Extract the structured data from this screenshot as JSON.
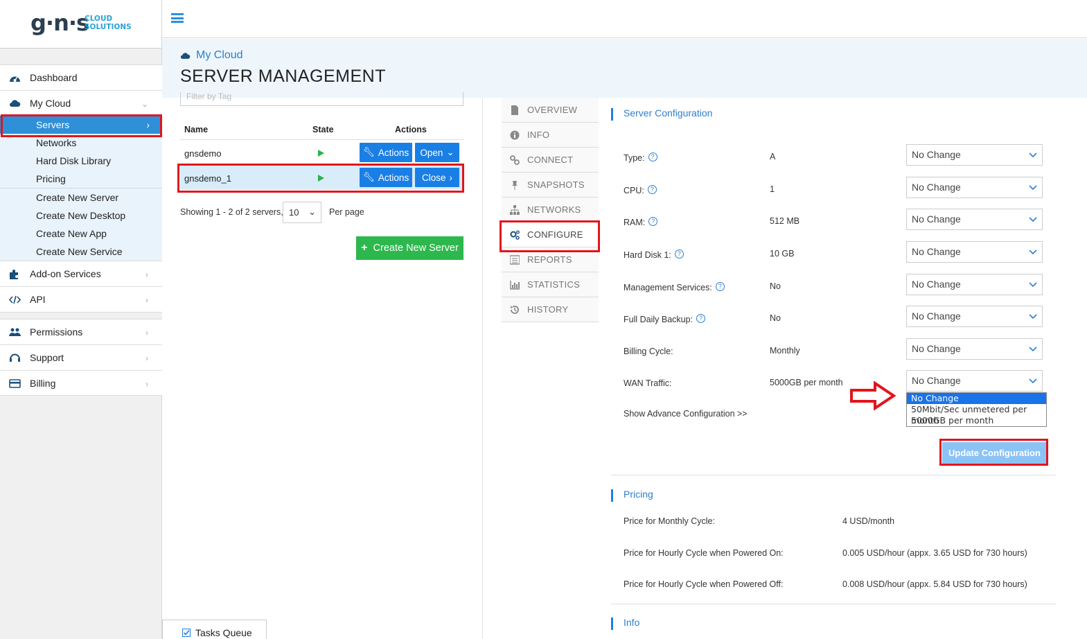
{
  "logo": {
    "brand": "g·n·s",
    "tagline_line1": "CLOUD",
    "tagline_line2": "SOLUTIONS"
  },
  "sidebar": {
    "dashboard": "Dashboard",
    "my_cloud": "My Cloud",
    "servers": "Servers",
    "networks": "Networks",
    "hard_disk_library": "Hard Disk Library",
    "pricing": "Pricing",
    "create_new_server": "Create New Server",
    "create_new_desktop": "Create New Desktop",
    "create_new_app": "Create New App",
    "create_new_service": "Create New Service",
    "addon_services": "Add-on Services",
    "api": "API",
    "permissions": "Permissions",
    "support": "Support",
    "billing": "Billing"
  },
  "header": {
    "breadcrumb": "My Cloud",
    "title": "SERVER MANAGEMENT"
  },
  "server_list": {
    "filter_placeholder": "Filter by Tag",
    "columns": {
      "name": "Name",
      "state": "State",
      "actions": "Actions"
    },
    "rows": [
      {
        "name": "gnsdemo",
        "actions_label": "Actions",
        "toggle_label": "Open"
      },
      {
        "name": "gnsdemo_1",
        "actions_label": "Actions",
        "toggle_label": "Close"
      }
    ],
    "showing": "Showing 1 - 2 of 2 servers,",
    "per_page_value": "10",
    "per_page_label": "Per page",
    "create_button": "Create New Server",
    "tasks_queue": "Tasks Queue"
  },
  "tabs": [
    "OVERVIEW",
    "INFO",
    "CONNECT",
    "SNAPSHOTS",
    "NETWORKS",
    "CONFIGURE",
    "REPORTS",
    "STATISTICS",
    "HISTORY"
  ],
  "active_tab": "CONFIGURE",
  "server_config": {
    "heading": "Server Configuration",
    "rows": [
      {
        "label": "Type:",
        "value": "A",
        "select": "No Change",
        "help": true
      },
      {
        "label": "CPU:",
        "value": "1",
        "select": "No Change",
        "help": true
      },
      {
        "label": "RAM:",
        "value": "512 MB",
        "select": "No Change",
        "help": true
      },
      {
        "label": "Hard Disk 1:",
        "value": "10 GB",
        "select": "No Change",
        "help": true
      },
      {
        "label": "Management Services:",
        "value": "No",
        "select": "No Change",
        "help": true
      },
      {
        "label": "Full Daily Backup:",
        "value": "No",
        "select": "No Change",
        "help": true
      },
      {
        "label": "Billing Cycle:",
        "value": "Monthly",
        "select": "No Change",
        "help": false
      },
      {
        "label": "WAN Traffic:",
        "value": "5000GB per month",
        "select": "No Change",
        "help": false
      }
    ],
    "wan_options": [
      "No Change",
      "50Mbit/Sec unmetered per month",
      "5000GB per month"
    ],
    "advanced_link": "Show Advance Configuration >>",
    "update_button": "Update Configuration"
  },
  "pricing": {
    "heading": "Pricing",
    "rows": [
      {
        "label": "Price for Monthly Cycle:",
        "value": "4 USD/month"
      },
      {
        "label": "Price for Hourly Cycle when Powered On:",
        "value": "0.005 USD/hour (appx. 3.65 USD for 730 hours)"
      },
      {
        "label": "Price for Hourly Cycle when Powered Off:",
        "value": "0.008 USD/hour (appx. 5.84 USD for 730 hours)"
      }
    ]
  },
  "info": {
    "heading": "Info"
  },
  "colors": {
    "accent": "#1a7fe5",
    "highlight_red": "#e3141c",
    "green": "#2db84d",
    "active_nav": "#2f8fd8"
  }
}
